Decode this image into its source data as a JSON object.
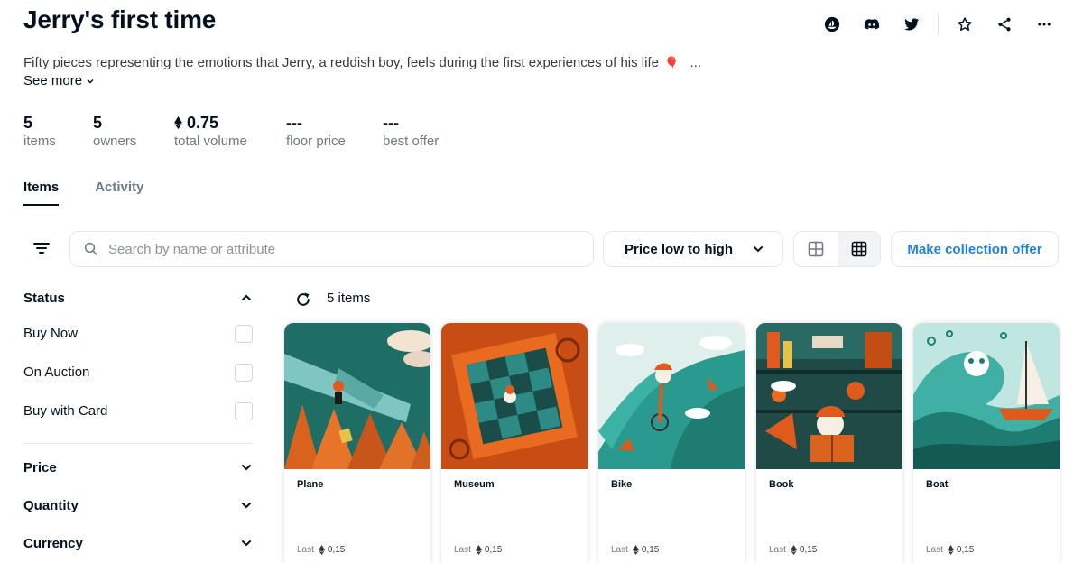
{
  "collection": {
    "title": "Jerry's first time",
    "description": "Fifty pieces representing the emotions that Jerry, a reddish boy, feels during the first experiences of his life",
    "description_emoji": "🎈",
    "ellipsis": "...",
    "see_more": "See more"
  },
  "header_icons": [
    "opensea-icon",
    "discord-icon",
    "twitter-icon",
    "star-icon",
    "share-icon",
    "more-icon"
  ],
  "stats": [
    {
      "value": "5",
      "label": "items"
    },
    {
      "value": "5",
      "label": "owners"
    },
    {
      "value": "0.75",
      "label": "total volume",
      "eth": true
    },
    {
      "value": "---",
      "label": "floor price"
    },
    {
      "value": "---",
      "label": "best offer"
    }
  ],
  "tabs": [
    {
      "label": "Items",
      "active": true
    },
    {
      "label": "Activity",
      "active": false
    }
  ],
  "search": {
    "placeholder": "Search by name or attribute",
    "value": ""
  },
  "sort": {
    "selected": "Price low to high"
  },
  "view_modes": [
    "large-grid",
    "small-grid"
  ],
  "active_view": "small-grid",
  "make_offer_label": "Make collection offer",
  "sidebar": {
    "status": {
      "title": "Status",
      "options": [
        {
          "label": "Buy Now",
          "checked": false
        },
        {
          "label": "On Auction",
          "checked": false
        },
        {
          "label": "Buy with Card",
          "checked": false
        }
      ]
    },
    "sections": [
      {
        "title": "Price"
      },
      {
        "title": "Quantity"
      },
      {
        "title": "Currency"
      }
    ]
  },
  "results": {
    "count_label": "5 items"
  },
  "items": [
    {
      "name": "Plane",
      "last_label": "Last",
      "last_price": "0,15"
    },
    {
      "name": "Museum",
      "last_label": "Last",
      "last_price": "0,15"
    },
    {
      "name": "Bike",
      "last_label": "Last",
      "last_price": "0,15"
    },
    {
      "name": "Book",
      "last_label": "Last",
      "last_price": "0,15"
    },
    {
      "name": "Boat",
      "last_label": "Last",
      "last_price": "0,15"
    }
  ],
  "colors": {
    "accent": "#2081e2",
    "text": "#04111d",
    "muted": "#707a83",
    "border": "#e5e8eb"
  }
}
